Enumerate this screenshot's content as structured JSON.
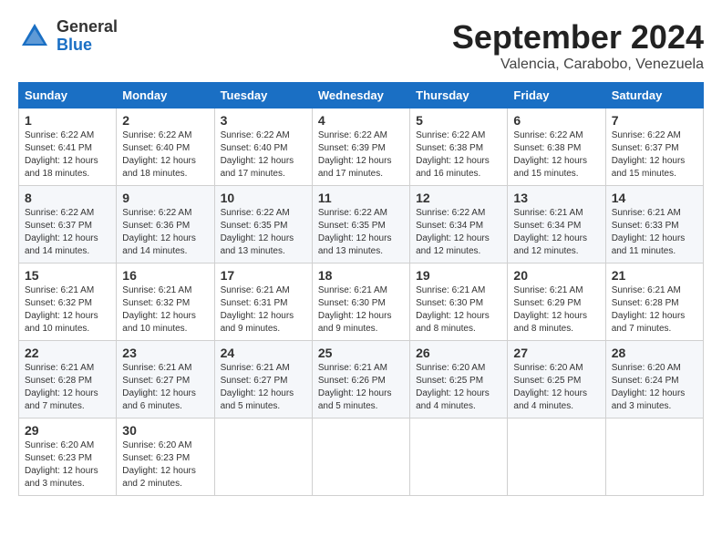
{
  "header": {
    "logo_general": "General",
    "logo_blue": "Blue",
    "month": "September 2024",
    "location": "Valencia, Carabobo, Venezuela"
  },
  "weekdays": [
    "Sunday",
    "Monday",
    "Tuesday",
    "Wednesday",
    "Thursday",
    "Friday",
    "Saturday"
  ],
  "weeks": [
    [
      {
        "day": "1",
        "sunrise": "6:22 AM",
        "sunset": "6:41 PM",
        "daylight": "12 hours and 18 minutes."
      },
      {
        "day": "2",
        "sunrise": "6:22 AM",
        "sunset": "6:40 PM",
        "daylight": "12 hours and 18 minutes."
      },
      {
        "day": "3",
        "sunrise": "6:22 AM",
        "sunset": "6:40 PM",
        "daylight": "12 hours and 17 minutes."
      },
      {
        "day": "4",
        "sunrise": "6:22 AM",
        "sunset": "6:39 PM",
        "daylight": "12 hours and 17 minutes."
      },
      {
        "day": "5",
        "sunrise": "6:22 AM",
        "sunset": "6:38 PM",
        "daylight": "12 hours and 16 minutes."
      },
      {
        "day": "6",
        "sunrise": "6:22 AM",
        "sunset": "6:38 PM",
        "daylight": "12 hours and 15 minutes."
      },
      {
        "day": "7",
        "sunrise": "6:22 AM",
        "sunset": "6:37 PM",
        "daylight": "12 hours and 15 minutes."
      }
    ],
    [
      {
        "day": "8",
        "sunrise": "6:22 AM",
        "sunset": "6:37 PM",
        "daylight": "12 hours and 14 minutes."
      },
      {
        "day": "9",
        "sunrise": "6:22 AM",
        "sunset": "6:36 PM",
        "daylight": "12 hours and 14 minutes."
      },
      {
        "day": "10",
        "sunrise": "6:22 AM",
        "sunset": "6:35 PM",
        "daylight": "12 hours and 13 minutes."
      },
      {
        "day": "11",
        "sunrise": "6:22 AM",
        "sunset": "6:35 PM",
        "daylight": "12 hours and 13 minutes."
      },
      {
        "day": "12",
        "sunrise": "6:22 AM",
        "sunset": "6:34 PM",
        "daylight": "12 hours and 12 minutes."
      },
      {
        "day": "13",
        "sunrise": "6:21 AM",
        "sunset": "6:34 PM",
        "daylight": "12 hours and 12 minutes."
      },
      {
        "day": "14",
        "sunrise": "6:21 AM",
        "sunset": "6:33 PM",
        "daylight": "12 hours and 11 minutes."
      }
    ],
    [
      {
        "day": "15",
        "sunrise": "6:21 AM",
        "sunset": "6:32 PM",
        "daylight": "12 hours and 10 minutes."
      },
      {
        "day": "16",
        "sunrise": "6:21 AM",
        "sunset": "6:32 PM",
        "daylight": "12 hours and 10 minutes."
      },
      {
        "day": "17",
        "sunrise": "6:21 AM",
        "sunset": "6:31 PM",
        "daylight": "12 hours and 9 minutes."
      },
      {
        "day": "18",
        "sunrise": "6:21 AM",
        "sunset": "6:30 PM",
        "daylight": "12 hours and 9 minutes."
      },
      {
        "day": "19",
        "sunrise": "6:21 AM",
        "sunset": "6:30 PM",
        "daylight": "12 hours and 8 minutes."
      },
      {
        "day": "20",
        "sunrise": "6:21 AM",
        "sunset": "6:29 PM",
        "daylight": "12 hours and 8 minutes."
      },
      {
        "day": "21",
        "sunrise": "6:21 AM",
        "sunset": "6:28 PM",
        "daylight": "12 hours and 7 minutes."
      }
    ],
    [
      {
        "day": "22",
        "sunrise": "6:21 AM",
        "sunset": "6:28 PM",
        "daylight": "12 hours and 7 minutes."
      },
      {
        "day": "23",
        "sunrise": "6:21 AM",
        "sunset": "6:27 PM",
        "daylight": "12 hours and 6 minutes."
      },
      {
        "day": "24",
        "sunrise": "6:21 AM",
        "sunset": "6:27 PM",
        "daylight": "12 hours and 5 minutes."
      },
      {
        "day": "25",
        "sunrise": "6:21 AM",
        "sunset": "6:26 PM",
        "daylight": "12 hours and 5 minutes."
      },
      {
        "day": "26",
        "sunrise": "6:20 AM",
        "sunset": "6:25 PM",
        "daylight": "12 hours and 4 minutes."
      },
      {
        "day": "27",
        "sunrise": "6:20 AM",
        "sunset": "6:25 PM",
        "daylight": "12 hours and 4 minutes."
      },
      {
        "day": "28",
        "sunrise": "6:20 AM",
        "sunset": "6:24 PM",
        "daylight": "12 hours and 3 minutes."
      }
    ],
    [
      {
        "day": "29",
        "sunrise": "6:20 AM",
        "sunset": "6:23 PM",
        "daylight": "12 hours and 3 minutes."
      },
      {
        "day": "30",
        "sunrise": "6:20 AM",
        "sunset": "6:23 PM",
        "daylight": "12 hours and 2 minutes."
      },
      null,
      null,
      null,
      null,
      null
    ]
  ]
}
